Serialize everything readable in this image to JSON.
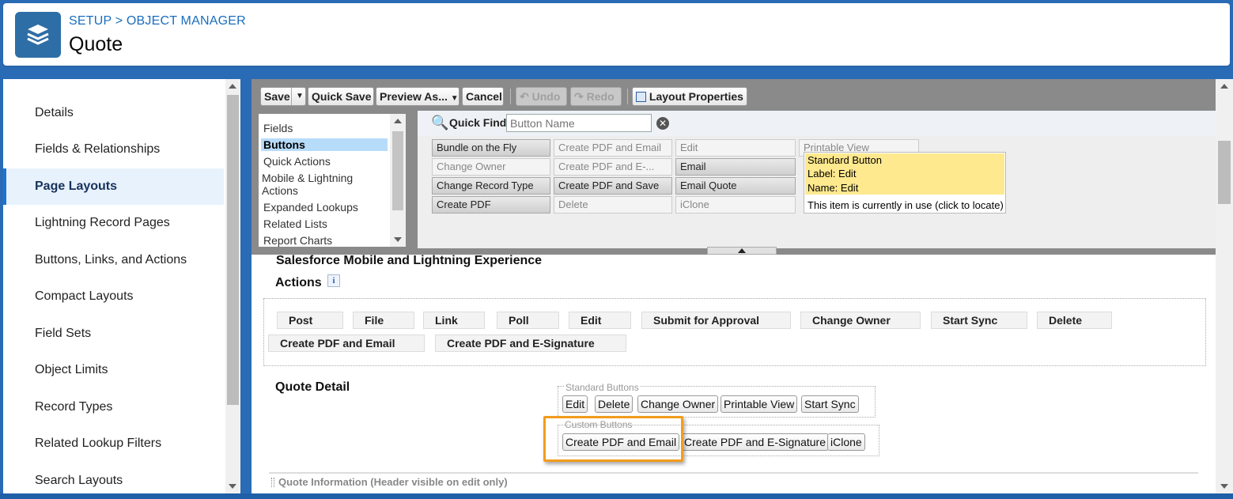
{
  "header": {
    "breadcrumb": "SETUP > OBJECT MANAGER",
    "title": "Quote",
    "logo_icon": "layers-icon"
  },
  "sidebar": {
    "items": [
      {
        "label": "Details",
        "active": false
      },
      {
        "label": "Fields & Relationships",
        "active": false
      },
      {
        "label": "Page Layouts",
        "active": true
      },
      {
        "label": "Lightning Record Pages",
        "active": false
      },
      {
        "label": "Buttons, Links, and Actions",
        "active": false
      },
      {
        "label": "Compact Layouts",
        "active": false
      },
      {
        "label": "Field Sets",
        "active": false
      },
      {
        "label": "Object Limits",
        "active": false
      },
      {
        "label": "Record Types",
        "active": false
      },
      {
        "label": "Related Lookup Filters",
        "active": false
      },
      {
        "label": "Search Layouts",
        "active": false
      }
    ]
  },
  "toolbar": {
    "save": "Save",
    "quick_save": "Quick Save",
    "preview_as": "Preview As...",
    "cancel": "Cancel",
    "undo": "Undo",
    "redo": "Redo",
    "layout_properties": "Layout Properties"
  },
  "palette": {
    "categories": [
      "Fields",
      "Buttons",
      "Quick Actions",
      "Mobile & Lightning Actions",
      "Expanded Lookups",
      "Related Lists",
      "Report Charts"
    ],
    "selected_category": "Buttons",
    "quick_find_label": "Quick Find",
    "quick_find_placeholder": "Button Name",
    "buttons": [
      {
        "label": "Bundle on the Fly",
        "used": true
      },
      {
        "label": "Create PDF and Email",
        "used": false
      },
      {
        "label": "Edit",
        "used": false
      },
      {
        "label": "Printable View",
        "used": false
      },
      {
        "label": "Change Owner",
        "used": false
      },
      {
        "label": "Create PDF and E-...",
        "used": false
      },
      {
        "label": "Email",
        "used": true
      },
      {
        "label": "Change Record Type",
        "used": true
      },
      {
        "label": "Create PDF and Save",
        "used": true
      },
      {
        "label": "Email Quote",
        "used": true
      },
      {
        "label": "Create PDF",
        "used": true
      },
      {
        "label": "Delete",
        "used": false
      },
      {
        "label": "iClone",
        "used": false
      }
    ],
    "tooltip": {
      "line1": "Standard Button",
      "line2": "Label: Edit",
      "line3": "Name: Edit",
      "footer": "This item is currently in use (click to locate)"
    }
  },
  "layout": {
    "section_mobile": "Salesforce Mobile and Lightning Experience",
    "section_actions": "Actions",
    "info_icon": "i",
    "actions": [
      "Post",
      "File",
      "Link",
      "Poll",
      "Edit",
      "Submit for Approval",
      "Change Owner",
      "Start Sync",
      "Delete",
      "Create PDF and Email",
      "Create PDF and E-Signature"
    ],
    "quote_detail": "Quote Detail",
    "standard_buttons_label": "Standard Buttons",
    "standard_buttons": [
      "Edit",
      "Delete",
      "Change Owner",
      "Printable View",
      "Start Sync"
    ],
    "custom_buttons_label": "Custom Buttons",
    "custom_buttons": [
      "Create PDF and Email",
      "Create PDF and E-Signature",
      "iClone"
    ],
    "quote_info_title": "Quote Information",
    "quote_info_sub": "(Header visible on edit only)"
  },
  "colors": {
    "accent": "#1b74d3",
    "highlight": "#f29c1c",
    "tooltip_bg": "#ffe98f",
    "logo_bg": "#2e6ea6"
  }
}
